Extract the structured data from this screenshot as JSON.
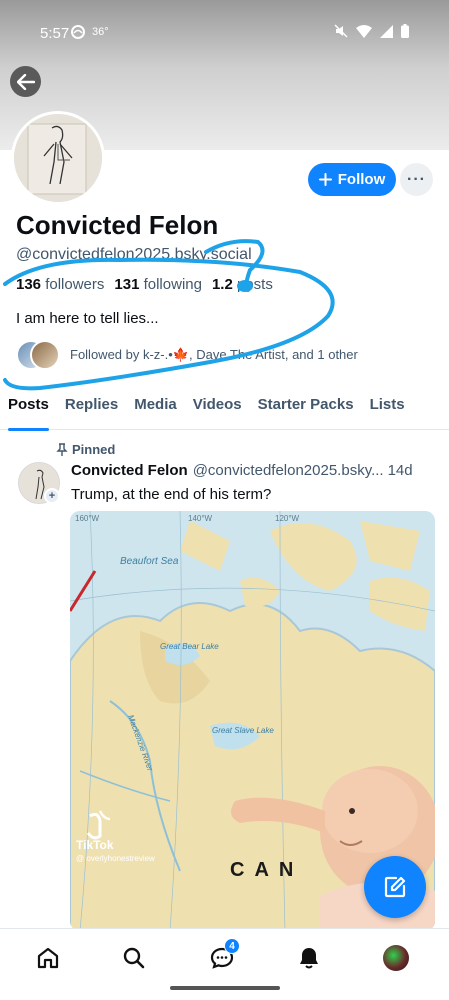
{
  "status_bar": {
    "time": "5:57",
    "temperature": "36°",
    "icons": [
      "weather-icon",
      "mute-icon",
      "wifi-icon",
      "signal-icon",
      "battery-icon"
    ]
  },
  "profile": {
    "display_name": "Convicted Felon",
    "handle": "@convictedfelon2025.bsky.social",
    "followers_count": "136",
    "followers_label": "followers",
    "following_count": "131",
    "following_label": "following",
    "posts_count": "1.2",
    "posts_label": "posts",
    "bio": "I am here to tell lies...",
    "followed_by_text": "Followed by k-z-.•🍁, Dave The Artist, and 1 other"
  },
  "actions": {
    "follow_label": "Follow",
    "more_label": "···"
  },
  "tabs": [
    {
      "label": "Posts",
      "active": true
    },
    {
      "label": "Replies",
      "active": false
    },
    {
      "label": "Media",
      "active": false
    },
    {
      "label": "Videos",
      "active": false
    },
    {
      "label": "Starter Packs",
      "active": false
    },
    {
      "label": "Lists",
      "active": false
    }
  ],
  "pinned_post": {
    "pinned_label": "Pinned",
    "author": "Convicted Felon",
    "handle": "@convictedfelon2025.bsky...",
    "time": "14d",
    "text": "Trump, at the end of his term?",
    "media": {
      "map_labels": [
        "Beaufort Sea",
        "Great Bear Lake",
        "Mackenzie River",
        "Great Slave Lake",
        "CAN"
      ],
      "longitudes": [
        "160°W",
        "140°W",
        "120°W"
      ],
      "watermark_brand": "TikTok",
      "watermark_user": "@ overlyhonestreview"
    }
  },
  "bottom_nav": {
    "items": [
      "home-icon",
      "search-icon",
      "chat-icon",
      "notifications-icon",
      "profile-avatar"
    ],
    "chat_badge": "4"
  },
  "colors": {
    "accent": "#1083fe",
    "scribble": "#1ea2e8",
    "text_secondary": "#42576c"
  }
}
